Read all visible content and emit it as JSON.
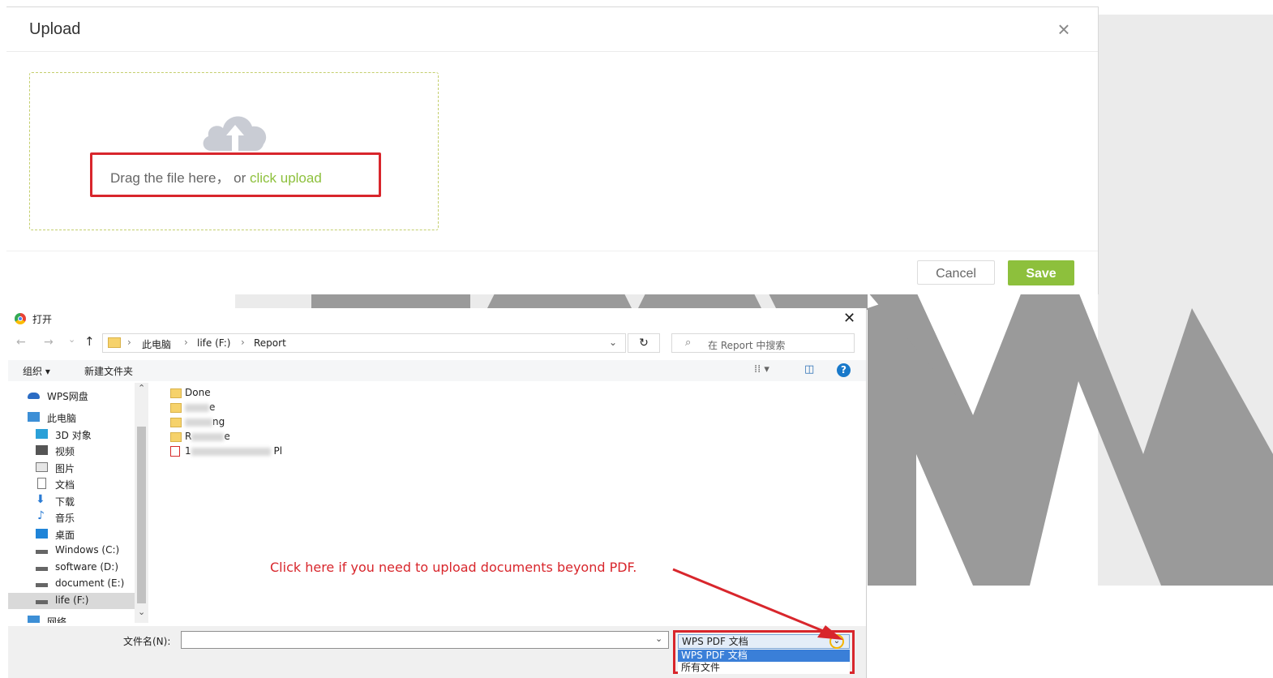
{
  "upload_modal": {
    "title": "Upload",
    "close_glyph": "×",
    "drop_text": "Drag the file here，  or ",
    "drop_link": "click upload",
    "cancel_label": "Cancel",
    "save_label": "Save",
    "accent_color": "#8dc03c",
    "highlight_color": "#d8262c"
  },
  "file_dialog": {
    "title": "打开",
    "close_glyph": "✕",
    "nav": {
      "back": "←",
      "forward": "→",
      "recent": "⌄",
      "up": "↑"
    },
    "breadcrumb": [
      "此电脑",
      "life (F:)",
      "Report"
    ],
    "refresh_glyph": "↻",
    "search_placeholder": "在 Report 中搜索",
    "toolbar": {
      "organize": "组织 ▾",
      "new_folder": "新建文件夹",
      "view": "⁞⁞ ▾",
      "pane": "◫",
      "help": "?"
    },
    "nav_items": [
      {
        "label": "WPS网盘",
        "icon": "cloud-drive-icon"
      },
      {
        "label": "此电脑",
        "icon": "computer-icon"
      },
      {
        "label": "3D 对象",
        "icon": "3d-objects-icon"
      },
      {
        "label": "视频",
        "icon": "video-icon"
      },
      {
        "label": "图片",
        "icon": "pictures-icon"
      },
      {
        "label": "文档",
        "icon": "documents-icon"
      },
      {
        "label": "下载",
        "icon": "download-icon"
      },
      {
        "label": "音乐",
        "icon": "music-icon"
      },
      {
        "label": "桌面",
        "icon": "desktop-icon"
      },
      {
        "label": "Windows (C:)",
        "icon": "drive-icon"
      },
      {
        "label": "software (D:)",
        "icon": "drive-icon"
      },
      {
        "label": "document (E:)",
        "icon": "drive-icon"
      },
      {
        "label": "life (F:)",
        "icon": "drive-icon"
      },
      {
        "label": "网络",
        "icon": "network-icon"
      }
    ],
    "files": [
      {
        "name_start": "Done",
        "name_end": "",
        "type": "folder"
      },
      {
        "name_start": "",
        "name_end": "e",
        "type": "folder"
      },
      {
        "name_start": "",
        "name_end": "ng",
        "type": "folder"
      },
      {
        "name_start": "R",
        "name_end": "e",
        "type": "folder"
      },
      {
        "name_start": "1",
        "name_end": "Pl",
        "type": "pdf"
      }
    ],
    "filename_label": "文件名(N):",
    "filename_value": "",
    "filetype_selected": "WPS PDF 文档",
    "filetype_options": [
      "WPS PDF 文档",
      "所有文件"
    ]
  },
  "annotation": "Click here if you need to upload documents beyond PDF."
}
